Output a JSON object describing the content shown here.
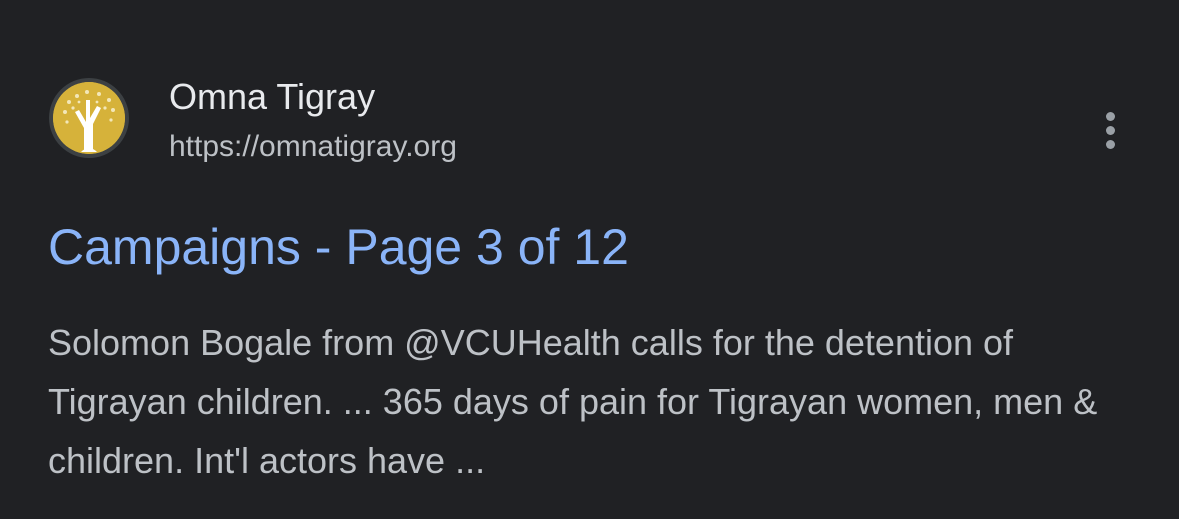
{
  "result": {
    "favicon": "omna-tigray-tree-logo",
    "site_name": "Omna Tigray",
    "site_url": "https://omnatigray.org",
    "more_options_icon": "vertical-ellipsis-icon",
    "title": "Campaigns - Page 3 of 12",
    "snippet": "Solomon Bogale from @VCUHealth calls for the detention of Tigrayan children. ... 365 days of pain for Tigrayan women, men & children. Int'l actors have ..."
  },
  "colors": {
    "background": "#202124",
    "title_link": "#8ab4f8",
    "site_name": "#e8eaed",
    "secondary_text": "#bdc1c6",
    "favicon_bg": "#d6b23a"
  }
}
